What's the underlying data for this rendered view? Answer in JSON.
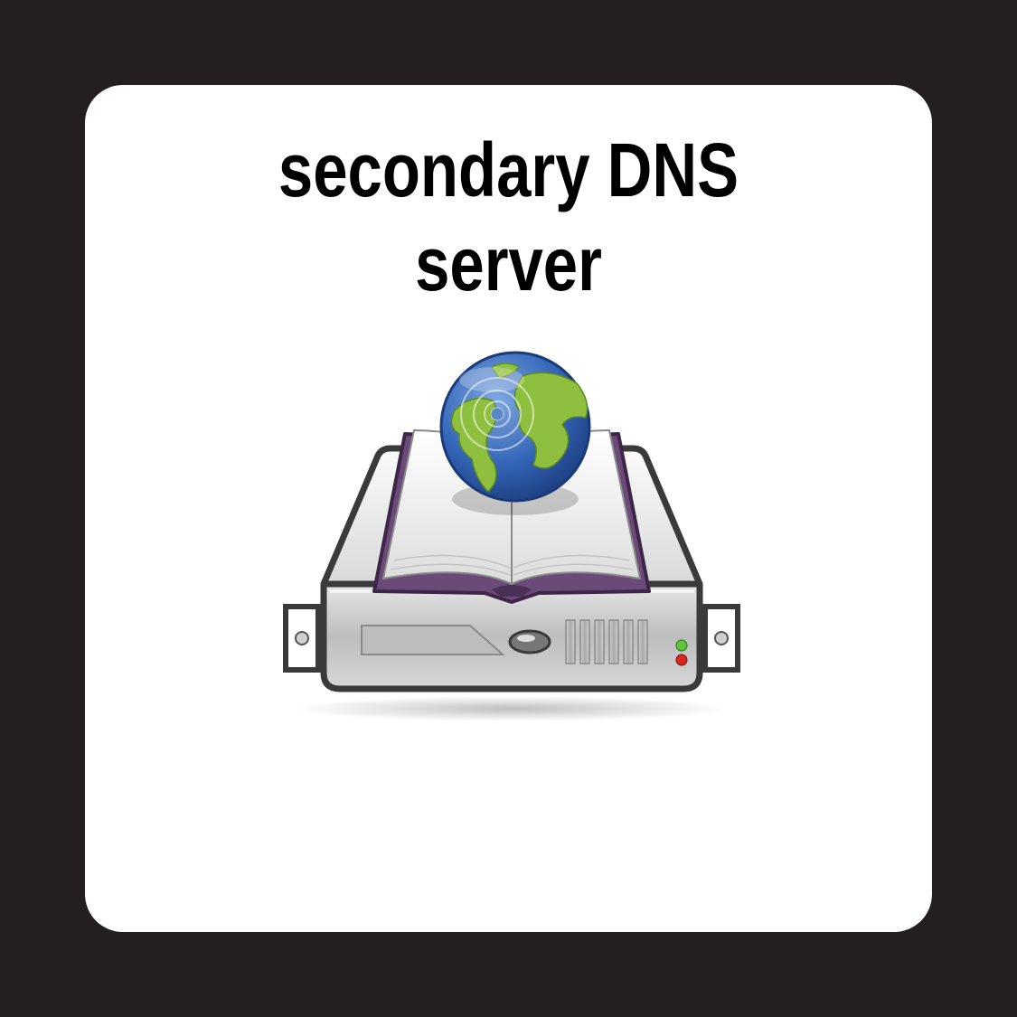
{
  "card": {
    "title_line1": "secondary DNS",
    "title_line2": "server"
  },
  "icon": {
    "name": "dns-server-book-globe-icon"
  }
}
